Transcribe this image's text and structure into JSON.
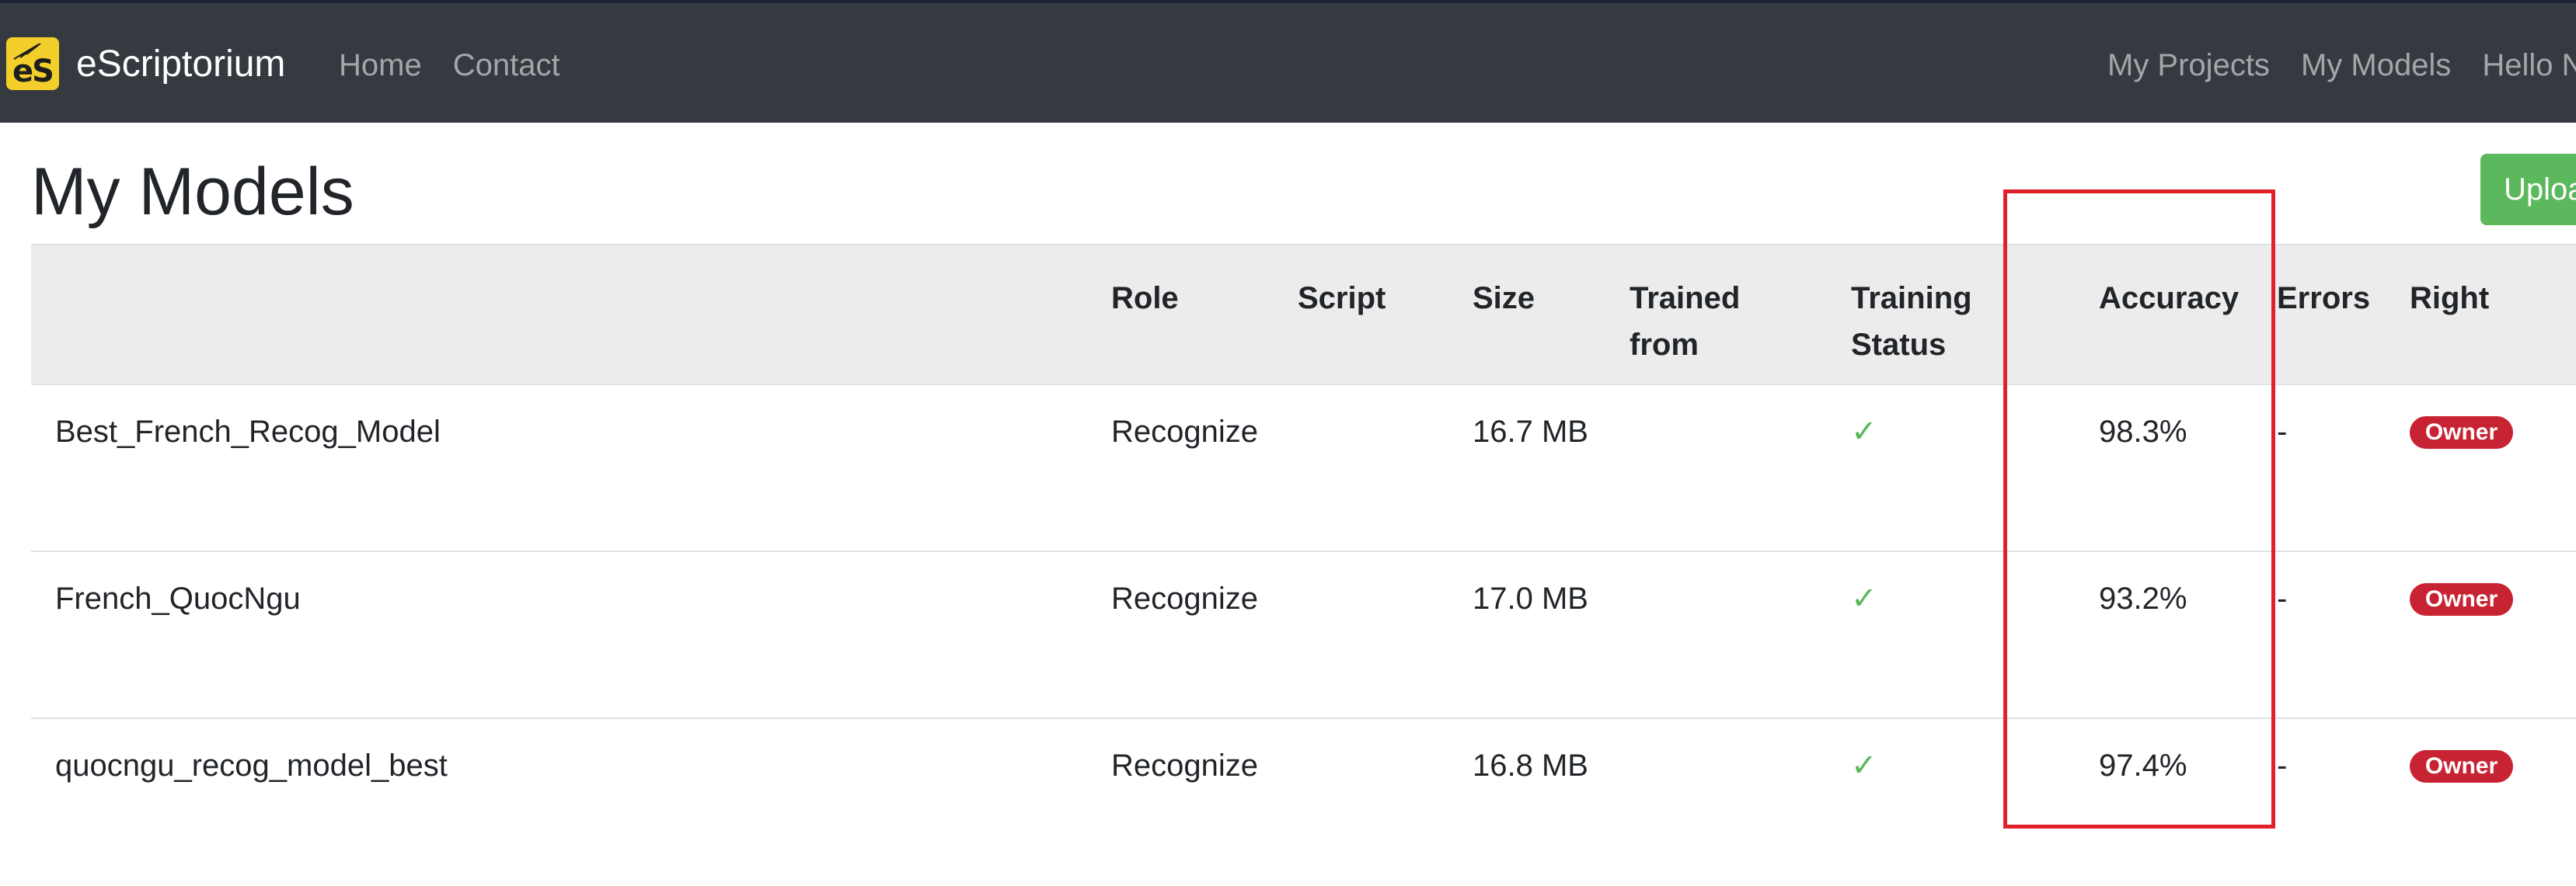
{
  "navbar": {
    "logo_text": "eS",
    "brand": "eScriptorium",
    "left_links": [
      "Home",
      "Contact"
    ],
    "right_links": [
      "My Projects",
      "My Models",
      "Hello N"
    ]
  },
  "page": {
    "title": "My Models",
    "upload_label": "Uploa"
  },
  "table": {
    "headers": {
      "role": "Role",
      "script": "Script",
      "size": "Size",
      "trained_from_1": "Trained",
      "trained_from_2": "from",
      "training_status_1": "Training",
      "training_status_2": "Status",
      "accuracy": "Accuracy",
      "errors": "Errors",
      "right": "Right"
    },
    "rows": [
      {
        "name": "Best_French_Recog_Model",
        "role": "Recognize",
        "script": "",
        "size": "16.7 MB",
        "trained_from": "",
        "status": "✓",
        "accuracy": "98.3%",
        "errors": "-",
        "right": "Owner"
      },
      {
        "name": "French_QuocNgu",
        "role": "Recognize",
        "script": "",
        "size": "17.0 MB",
        "trained_from": "",
        "status": "✓",
        "accuracy": "93.2%",
        "errors": "-",
        "right": "Owner"
      },
      {
        "name": "quocngu_recog_model_best",
        "role": "Recognize",
        "script": "",
        "size": "16.8 MB",
        "trained_from": "",
        "status": "✓",
        "accuracy": "97.4%",
        "errors": "-",
        "right": "Owner"
      }
    ]
  },
  "colors": {
    "navbar_bg": "#343a40",
    "success": "#5cb85c",
    "danger": "#c82333",
    "header_bg": "#ececec",
    "highlight": "#e0202a"
  }
}
